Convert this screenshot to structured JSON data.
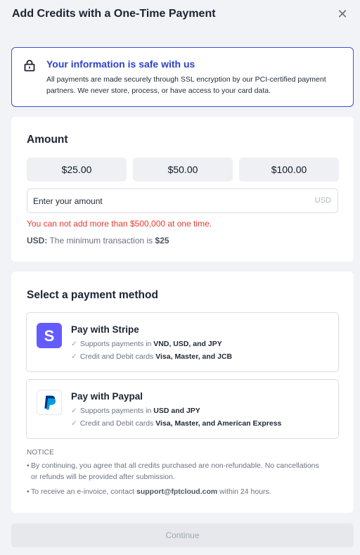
{
  "dialog": {
    "title": "Add Credits with a One-Time Payment",
    "close_icon": "close-icon"
  },
  "security": {
    "icon": "lock-icon",
    "title": "Your information is safe with us",
    "body": "All payments are made securely through SSL encryption by our PCI-certified payment partners. We never store, process, or have access to your card data.",
    "border_color": "#3b54d4",
    "title_color": "#2c43c9"
  },
  "amount": {
    "heading": "Amount",
    "presets": [
      "$25.00",
      "$50.00",
      "$100.00"
    ],
    "input_placeholder": "Enter your amount",
    "input_value": "",
    "unit": "USD",
    "error": "You can not add more than $500,000 at one time.",
    "error_color": "#e23b2e",
    "minimum_currency": "USD:",
    "minimum_text": "The minimum transaction is",
    "minimum_value": "$25"
  },
  "payment": {
    "heading": "Select a payment method",
    "methods": [
      {
        "name": "Pay with Stripe",
        "icon": "stripe-logo-icon",
        "brand_color": "#635bff",
        "line1_prefix": "Supports payments in",
        "line1_value": "VND, USD, and JPY",
        "line2_prefix": "Credit and Debit cards",
        "line2_value": "Visa, Master, and JCB"
      },
      {
        "name": "Pay with Paypal",
        "icon": "paypal-logo-icon",
        "brand_color": "#003087",
        "line1_prefix": "Supports payments in",
        "line1_value": "USD and JPY",
        "line2_prefix": "Credit and Debit cards",
        "line2_value": "Visa, Master, and American Express"
      }
    ]
  },
  "notice": {
    "heading": "NOTICE",
    "item1": "By continuing, you agree that all credits purchased are non-refundable. No cancellations or refunds will be provided after submission.",
    "item2_prefix": "To receive an e-invoice, contact",
    "item2_email": "support@fptcloud.com",
    "item2_suffix": "within 24 hours."
  },
  "footer": {
    "continue_label": "Continue"
  }
}
